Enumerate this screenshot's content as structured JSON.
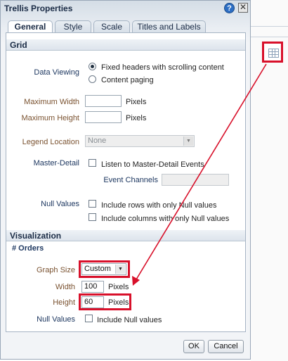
{
  "dialog": {
    "title": "Trellis Properties",
    "help_glyph": "?",
    "close_glyph": "✕",
    "tabs": [
      {
        "label": "General",
        "active": true
      },
      {
        "label": "Style",
        "active": false
      },
      {
        "label": "Scale",
        "active": false
      },
      {
        "label": "Titles and Labels",
        "active": false
      }
    ]
  },
  "grid": {
    "header": "Grid",
    "data_viewing": {
      "label": "Data Viewing",
      "options": [
        {
          "label": "Fixed headers with scrolling content",
          "selected": true
        },
        {
          "label": "Content paging",
          "selected": false
        }
      ]
    },
    "max_width": {
      "label": "Maximum Width",
      "value": "",
      "unit": "Pixels"
    },
    "max_height": {
      "label": "Maximum Height",
      "value": "",
      "unit": "Pixels"
    },
    "legend_location": {
      "label": "Legend Location",
      "value": "None"
    },
    "master_detail": {
      "label": "Master-Detail",
      "checkbox_label": "Listen to Master-Detail Events",
      "checked": false
    },
    "event_channels": {
      "label": "Event Channels",
      "value": ""
    },
    "null_values": {
      "label": "Null Values",
      "options": [
        {
          "label": "Include rows with only Null values",
          "checked": false
        },
        {
          "label": "Include columns with only Null values",
          "checked": false
        }
      ]
    }
  },
  "visualization": {
    "header": "Visualization",
    "subheader": "# Orders",
    "graph_size": {
      "label": "Graph Size",
      "value": "Custom"
    },
    "width": {
      "label": "Width",
      "value": "100",
      "unit": "Pixels"
    },
    "height": {
      "label": "Height",
      "value": "60",
      "unit": "Pixels"
    },
    "null_values": {
      "label": "Null Values",
      "checkbox_label": "Include Null values",
      "checked": false
    }
  },
  "footer": {
    "ok_label": "OK",
    "cancel_label": "Cancel"
  },
  "colors": {
    "highlight": "#d8102a",
    "accent_navy": "#1d3760",
    "label_brown": "#7a5230"
  },
  "icons": {
    "background_toolbar": "trellis-grid-icon"
  }
}
